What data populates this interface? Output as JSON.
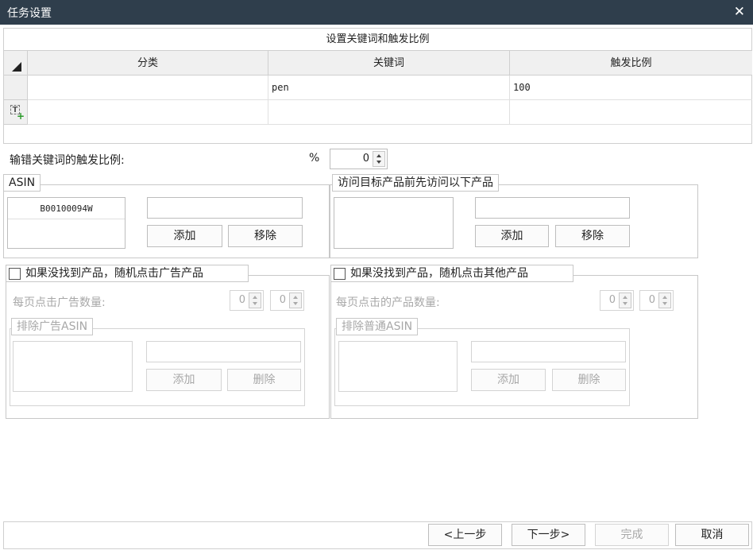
{
  "window": {
    "title": "任务设置",
    "close_glyph": "✕"
  },
  "grid": {
    "caption": "设置关键词和触发比例",
    "columns": [
      "分类",
      "关键词",
      "触发比例"
    ],
    "rows": [
      {
        "category": "",
        "keyword": "pen",
        "ratio": "100"
      }
    ]
  },
  "misspell": {
    "label": "输错关键词的触发比例:",
    "percent": "%",
    "value": "0"
  },
  "asin_group": {
    "legend": "ASIN",
    "items": [
      "B00100094W"
    ],
    "input_value": "",
    "add_label": "添加",
    "remove_label": "移除"
  },
  "visit_group": {
    "legend": "访问目标产品前先访问以下产品",
    "input_value": "",
    "add_label": "添加",
    "remove_label": "移除"
  },
  "ad_group": {
    "checkbox_label": "如果没找到产品，随机点击广告产品",
    "checked": false,
    "count_label": "每页点击广告数量:",
    "min_value": "0",
    "max_value": "0",
    "exclude_legend": "排除广告ASIN",
    "add_label": "添加",
    "delete_label": "删除"
  },
  "other_group": {
    "checkbox_label": "如果没找到产品，随机点击其他产品",
    "checked": false,
    "count_label": "每页点击的产品数量:",
    "min_value": "0",
    "max_value": "0",
    "exclude_legend": "排除普通ASIN",
    "add_label": "添加",
    "delete_label": "删除"
  },
  "footer": {
    "prev": "<上一步",
    "next": "下一步>",
    "finish": "完成",
    "cancel": "取消"
  },
  "colors": {
    "titlebar": "#2f3e4c",
    "disabled_text": "#a8a8a8",
    "border": "#c8c8c8"
  }
}
